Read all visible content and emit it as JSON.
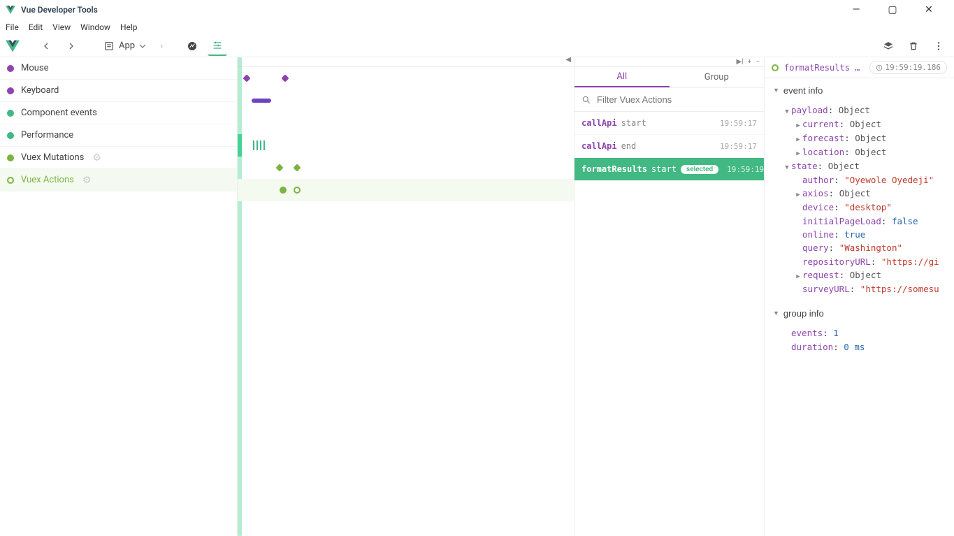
{
  "window": {
    "title": "Vue Developer Tools",
    "menu": [
      "File",
      "Edit",
      "View",
      "Window",
      "Help"
    ]
  },
  "toolbar": {
    "app_label": "App"
  },
  "layers": [
    {
      "name": "Mouse",
      "color": "purple",
      "isPlugin": false,
      "active": false
    },
    {
      "name": "Keyboard",
      "color": "purple",
      "isPlugin": false,
      "active": false
    },
    {
      "name": "Component events",
      "color": "teal",
      "isPlugin": false,
      "active": false
    },
    {
      "name": "Performance",
      "color": "teal",
      "isPlugin": false,
      "active": false
    },
    {
      "name": "Vuex Mutations",
      "color": "green",
      "isPlugin": true,
      "active": false
    },
    {
      "name": "Vuex Actions",
      "color": "green",
      "isPlugin": true,
      "active": true
    }
  ],
  "events_pane": {
    "tabs": {
      "all": "All",
      "group": "Group",
      "active": "all"
    },
    "filter_placeholder": "Filter Vuex Actions",
    "rows": [
      {
        "name": "callApi",
        "phase": "start",
        "time": "19:59:17",
        "selected": false
      },
      {
        "name": "callApi",
        "phase": "end",
        "time": "19:59:17",
        "selected": false
      },
      {
        "name": "formatResults",
        "phase": "start",
        "time": "19:59:19",
        "selected": true,
        "badge": "selected"
      }
    ]
  },
  "inspector": {
    "header_name": "formatResults s…",
    "header_time": "19:59:19.186",
    "sections": {
      "event_info": "event info",
      "group_info": "group info"
    },
    "payload_label": "payload",
    "object_label": "Object",
    "payload": {
      "current": "Object",
      "forecast": "Object",
      "location": "Object"
    },
    "state_label": "state",
    "state": {
      "author": "\"Oyewole Oyedeji\"",
      "axios": "Object",
      "device": "\"desktop\"",
      "initialPageLoad": "false",
      "online": "true",
      "query": "\"Washington\"",
      "repositoryURL": "\"https://gi",
      "request": "Object",
      "surveyURL": "\"https://somesu"
    },
    "group": {
      "events_label": "events",
      "events": "1",
      "duration_label": "duration",
      "duration": "0 ms"
    }
  }
}
